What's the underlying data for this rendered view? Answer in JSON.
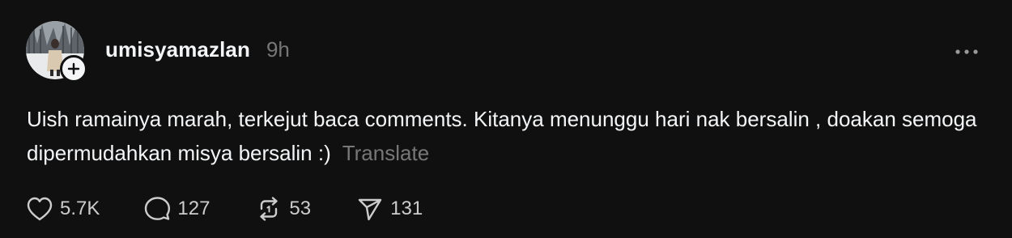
{
  "post": {
    "username": "umisyamazlan",
    "time": "9h",
    "text": "Uish ramainya marah, terkejut baca comments. Kitanya menunggu hari nak bersalin , doakan semoga dipermudahkan misya bersalin :)",
    "translate_label": "Translate",
    "avatar_icon": "profile-photo",
    "follow_icon": "plus-icon",
    "more_icon": "more-horizontal-icon"
  },
  "actions": {
    "likes": {
      "icon": "heart-icon",
      "count": "5.7K"
    },
    "replies": {
      "icon": "comment-icon",
      "count": "127"
    },
    "reposts": {
      "icon": "repost-icon",
      "count": "53"
    },
    "shares": {
      "icon": "send-icon",
      "count": "131"
    }
  },
  "colors": {
    "background": "#101010",
    "primary_text": "#f3f5f7",
    "secondary_text": "#777777"
  }
}
